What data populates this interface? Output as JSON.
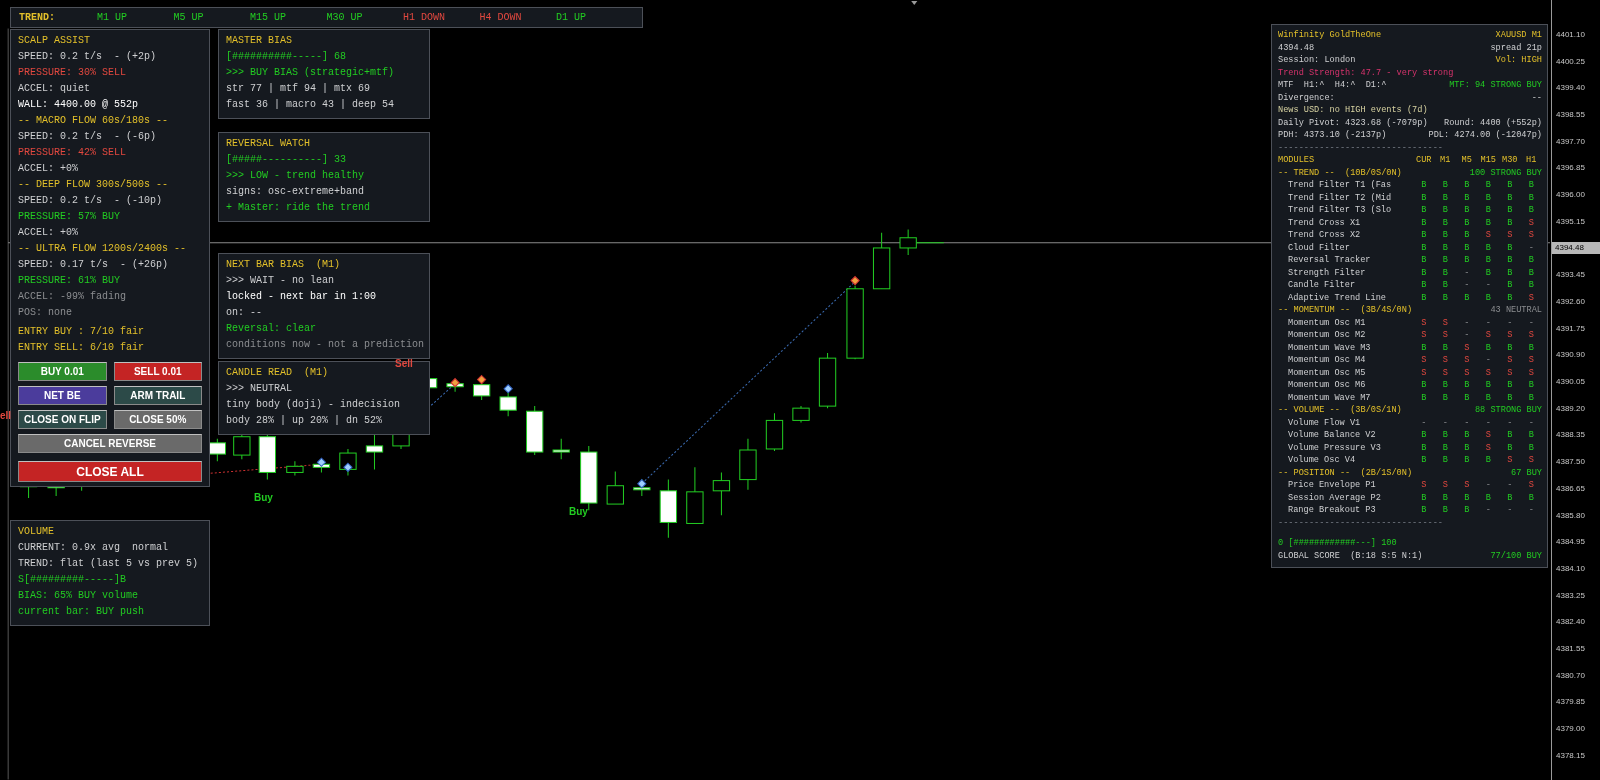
{
  "trend_bar": {
    "label": "TREND:",
    "items": [
      {
        "text": "M1 UP",
        "kind": "buy"
      },
      {
        "text": "M5 UP",
        "kind": "buy"
      },
      {
        "text": "M15 UP",
        "kind": "buy"
      },
      {
        "text": "M30 UP",
        "kind": "buy"
      },
      {
        "text": "H1 DOWN",
        "kind": "sell"
      },
      {
        "text": "H4 DOWN",
        "kind": "sell"
      },
      {
        "text": "D1 UP",
        "kind": "buy"
      }
    ]
  },
  "scalp_assist": {
    "lines": [
      {
        "text": "SCALP ASSIST",
        "kind": "heading"
      },
      {
        "text": "SPEED: 0.2 t/s  - (+2p)",
        "kind": "text"
      },
      {
        "text": "PRESSURE: 30% SELL",
        "kind": "sell"
      },
      {
        "text": "ACCEL: quiet",
        "kind": "text"
      },
      {
        "text": "WALL: 4400.00 @ 552p",
        "kind": "bright"
      },
      {
        "text": "-- MACRO FLOW 60s/180s --",
        "kind": "heading"
      },
      {
        "text": "SPEED: 0.2 t/s  - (-6p)",
        "kind": "text"
      },
      {
        "text": "PRESSURE: 42% SELL",
        "kind": "sell"
      },
      {
        "text": "ACCEL: +0%",
        "kind": "text"
      },
      {
        "text": "-- DEEP FLOW 300s/500s --",
        "kind": "heading"
      },
      {
        "text": "SPEED: 0.2 t/s  - (-10p)",
        "kind": "text"
      },
      {
        "text": "PRESSURE: 57% BUY",
        "kind": "buy"
      },
      {
        "text": "ACCEL: +0%",
        "kind": "text"
      },
      {
        "text": "-- ULTRA FLOW 1200s/2400s --",
        "kind": "heading"
      },
      {
        "text": "SPEED: 0.17 t/s  - (+26p)",
        "kind": "text"
      },
      {
        "text": "PRESSURE: 61% BUY",
        "kind": "buy"
      },
      {
        "text": "ACCEL: -99% fading",
        "kind": "dim"
      },
      {
        "text": "POS: none",
        "kind": "dim"
      }
    ],
    "entries": [
      {
        "text": "ENTRY BUY : 7/10 fair",
        "kind": "heading"
      },
      {
        "text": "ENTRY SELL: 6/10 fair",
        "kind": "heading"
      }
    ],
    "buttons": [
      {
        "label": "BUY 0.01",
        "color": "#2b8c2b",
        "kind": "half"
      },
      {
        "label": "SELL 0.01",
        "color": "#c42424",
        "kind": "half"
      },
      {
        "label": "NET BE",
        "color": "#4b3c9c",
        "kind": "half"
      },
      {
        "label": "ARM TRAIL",
        "color": "#2c4a48",
        "kind": "half"
      },
      {
        "label": "CLOSE ON FLIP",
        "color": "#2c4a48",
        "kind": "half"
      },
      {
        "label": "CLOSE 50%",
        "color": "#6a6a6a",
        "kind": "half"
      },
      {
        "label": "CANCEL REVERSE",
        "color": "#6a6a6a",
        "kind": "full"
      },
      {
        "label": "CLOSE ALL",
        "color": "#c42424",
        "kind": "full"
      }
    ]
  },
  "info_panels": [
    {
      "lines": [
        {
          "text": "MASTER BIAS",
          "kind": "heading"
        },
        {
          "text": "[##########-----] 68",
          "kind": "buy"
        },
        {
          "text": ">>> BUY BIAS (strategic+mtf)",
          "kind": "buy"
        },
        {
          "text": "str 77 | mtf 94 | mtx 69",
          "kind": "text"
        },
        {
          "text": "fast 36 | macro 43 | deep 54",
          "kind": "text"
        }
      ]
    },
    {
      "lines": [
        {
          "text": "REVERSAL WATCH",
          "kind": "heading"
        },
        {
          "text": "[#####----------] 33",
          "kind": "buy"
        },
        {
          "text": ">>> LOW - trend healthy",
          "kind": "buy"
        },
        {
          "text": "signs: osc-extreme+band",
          "kind": "text"
        },
        {
          "text": "+ Master: ride the trend",
          "kind": "buy"
        }
      ]
    },
    {
      "lines": [
        {
          "text": "NEXT BAR BIAS  (M1)",
          "kind": "heading"
        },
        {
          "text": ">>> WAIT - no lean",
          "kind": "text"
        },
        {
          "text": "locked - next bar in 1:00",
          "kind": "bright"
        },
        {
          "text": "on: --",
          "kind": "text"
        },
        {
          "text": "Reversal: clear",
          "kind": "buy"
        },
        {
          "text": "conditions now - not a prediction",
          "kind": "dim"
        }
      ]
    },
    {
      "lines": [
        {
          "text": "CANDLE READ  (M1)",
          "kind": "heading"
        },
        {
          "text": ">>> NEUTRAL",
          "kind": "text"
        },
        {
          "text": "tiny body (doji) - indecision",
          "kind": "text"
        },
        {
          "text": "body 28% | up 20% | dn 52%",
          "kind": "text"
        }
      ]
    },
    {
      "lines": [
        {
          "text": "VOLUME",
          "kind": "heading"
        },
        {
          "text": "CURRENT: 0.9x avg  normal",
          "kind": "text"
        },
        {
          "text": "TREND: flat (last 5 vs prev 5)",
          "kind": "text"
        },
        {
          "text": "S[#########-----]B",
          "kind": "buy"
        },
        {
          "text": "BIAS: 65% BUY volume",
          "kind": "buy"
        },
        {
          "text": "current bar: BUY push",
          "kind": "buy"
        }
      ]
    }
  ],
  "chart_labels": [
    {
      "text": "ell",
      "kind": "sell"
    },
    {
      "text": "Sell",
      "kind": "sell"
    },
    {
      "text": "Buy",
      "kind": "buy"
    },
    {
      "text": "Buy",
      "kind": "buy"
    }
  ],
  "dashboard": {
    "header_rows": [
      {
        "left": {
          "text": "Winfinity GoldTheOne",
          "kind": "heading"
        },
        "right": {
          "text": "XAUUSD M1",
          "kind": "heading"
        }
      },
      {
        "left": {
          "text": "4394.48",
          "kind": "text"
        },
        "right": {
          "text": "spread 21p",
          "kind": "text"
        }
      },
      {
        "left": {
          "text": "Session: London",
          "kind": "text"
        },
        "right": {
          "text": "Vol: HIGH",
          "kind": "heading"
        }
      },
      {
        "left": {
          "text": "Trend Strength: 47.7 - very strong",
          "kind": "pink"
        }
      },
      {
        "left": {
          "text": "MTF  H1:^  H4:^  D1:^",
          "kind": "text"
        },
        "right": {
          "text": "MTF: 94 STRONG BUY",
          "kind": "buy"
        }
      },
      {
        "left": {
          "text": "Divergence:",
          "kind": "text"
        },
        "right": {
          "text": "--",
          "kind": "text"
        }
      },
      {
        "left": {
          "text": "News USD: no HIGH events (7d)",
          "kind": "khaki"
        }
      },
      {
        "left": {
          "text": "Daily Pivot: 4323.68 (-7079p)",
          "kind": "text"
        },
        "right": {
          "text": "Round: 4400 (+552p)",
          "kind": "text"
        }
      },
      {
        "left": {
          "text": "PDH: 4373.10 (-2137p)",
          "kind": "text"
        },
        "right": {
          "text": "PDL: 4274.00 (-12047p)",
          "kind": "text"
        }
      }
    ],
    "divider": "--------------------------------",
    "columns": [
      "MODULES",
      "CUR",
      "M1",
      "M5",
      "M15",
      "M30",
      "H1"
    ],
    "groups": [
      {
        "label": "-- TREND --  (10B/0S/0N)",
        "summary": "100 STRONG BUY",
        "kind": "buy",
        "modules": [
          {
            "name": "Trend Filter T1 (Fas",
            "signals": [
              {
                "v": "B",
                "kind": "buy"
              },
              {
                "v": "B",
                "kind": "buy"
              },
              {
                "v": "B",
                "kind": "buy"
              },
              {
                "v": "B",
                "kind": "buy"
              },
              {
                "v": "B",
                "kind": "buy"
              },
              {
                "v": "B",
                "kind": "buy"
              }
            ]
          },
          {
            "name": "Trend Filter T2 (Mid",
            "signals": [
              {
                "v": "B",
                "kind": "buy"
              },
              {
                "v": "B",
                "kind": "buy"
              },
              {
                "v": "B",
                "kind": "buy"
              },
              {
                "v": "B",
                "kind": "buy"
              },
              {
                "v": "B",
                "kind": "buy"
              },
              {
                "v": "B",
                "kind": "buy"
              }
            ]
          },
          {
            "name": "Trend Filter T3 (Slo",
            "signals": [
              {
                "v": "B",
                "kind": "buy"
              },
              {
                "v": "B",
                "kind": "buy"
              },
              {
                "v": "B",
                "kind": "buy"
              },
              {
                "v": "B",
                "kind": "buy"
              },
              {
                "v": "B",
                "kind": "buy"
              },
              {
                "v": "B",
                "kind": "buy"
              }
            ]
          },
          {
            "name": "Trend Cross X1",
            "signals": [
              {
                "v": "B",
                "kind": "buy"
              },
              {
                "v": "B",
                "kind": "buy"
              },
              {
                "v": "B",
                "kind": "buy"
              },
              {
                "v": "B",
                "kind": "buy"
              },
              {
                "v": "B",
                "kind": "buy"
              },
              {
                "v": "S",
                "kind": "sell"
              }
            ]
          },
          {
            "name": "Trend Cross X2",
            "signals": [
              {
                "v": "B",
                "kind": "buy"
              },
              {
                "v": "B",
                "kind": "buy"
              },
              {
                "v": "B",
                "kind": "buy"
              },
              {
                "v": "S",
                "kind": "sell"
              },
              {
                "v": "S",
                "kind": "sell"
              },
              {
                "v": "S",
                "kind": "sell"
              }
            ]
          },
          {
            "name": "Cloud Filter",
            "signals": [
              {
                "v": "B",
                "kind": "buy"
              },
              {
                "v": "B",
                "kind": "buy"
              },
              {
                "v": "B",
                "kind": "buy"
              },
              {
                "v": "B",
                "kind": "buy"
              },
              {
                "v": "B",
                "kind": "buy"
              },
              {
                "v": "-",
                "kind": "none"
              }
            ]
          },
          {
            "name": "Reversal Tracker",
            "signals": [
              {
                "v": "B",
                "kind": "buy"
              },
              {
                "v": "B",
                "kind": "buy"
              },
              {
                "v": "B",
                "kind": "buy"
              },
              {
                "v": "B",
                "kind": "buy"
              },
              {
                "v": "B",
                "kind": "buy"
              },
              {
                "v": "B",
                "kind": "buy"
              }
            ]
          },
          {
            "name": "Strength Filter",
            "signals": [
              {
                "v": "B",
                "kind": "buy"
              },
              {
                "v": "B",
                "kind": "buy"
              },
              {
                "v": "-",
                "kind": "none"
              },
              {
                "v": "B",
                "kind": "buy"
              },
              {
                "v": "B",
                "kind": "buy"
              },
              {
                "v": "B",
                "kind": "buy"
              }
            ]
          },
          {
            "name": "Candle Filter",
            "signals": [
              {
                "v": "B",
                "kind": "buy"
              },
              {
                "v": "B",
                "kind": "buy"
              },
              {
                "v": "-",
                "kind": "none"
              },
              {
                "v": "-",
                "kind": "none"
              },
              {
                "v": "B",
                "kind": "buy"
              },
              {
                "v": "B",
                "kind": "buy"
              }
            ]
          },
          {
            "name": "Adaptive Trend Line",
            "signals": [
              {
                "v": "B",
                "kind": "buy"
              },
              {
                "v": "B",
                "kind": "buy"
              },
              {
                "v": "B",
                "kind": "buy"
              },
              {
                "v": "B",
                "kind": "buy"
              },
              {
                "v": "B",
                "kind": "buy"
              },
              {
                "v": "S",
                "kind": "sell"
              }
            ]
          }
        ]
      },
      {
        "label": "-- MOMENTUM --  (3B/4S/0N)",
        "summary": "43 NEUTRAL",
        "kind": "dim",
        "modules": [
          {
            "name": "Momentum Osc M1",
            "signals": [
              {
                "v": "S",
                "kind": "sell"
              },
              {
                "v": "S",
                "kind": "sell"
              },
              {
                "v": "-",
                "kind": "none"
              },
              {
                "v": "-",
                "kind": "none"
              },
              {
                "v": "-",
                "kind": "none"
              },
              {
                "v": "-",
                "kind": "none"
              }
            ]
          },
          {
            "name": "Momentum Osc M2",
            "signals": [
              {
                "v": "S",
                "kind": "sell"
              },
              {
                "v": "S",
                "kind": "sell"
              },
              {
                "v": "-",
                "kind": "none"
              },
              {
                "v": "S",
                "kind": "sell"
              },
              {
                "v": "S",
                "kind": "sell"
              },
              {
                "v": "S",
                "kind": "sell"
              }
            ]
          },
          {
            "name": "Momentum Wave M3",
            "signals": [
              {
                "v": "B",
                "kind": "buy"
              },
              {
                "v": "B",
                "kind": "buy"
              },
              {
                "v": "S",
                "kind": "sell"
              },
              {
                "v": "B",
                "kind": "buy"
              },
              {
                "v": "B",
                "kind": "buy"
              },
              {
                "v": "B",
                "kind": "buy"
              }
            ]
          },
          {
            "name": "Momentum Osc M4",
            "signals": [
              {
                "v": "S",
                "kind": "sell"
              },
              {
                "v": "S",
                "kind": "sell"
              },
              {
                "v": "S",
                "kind": "sell"
              },
              {
                "v": "-",
                "kind": "none"
              },
              {
                "v": "S",
                "kind": "sell"
              },
              {
                "v": "S",
                "kind": "sell"
              }
            ]
          },
          {
            "name": "Momentum Osc M5",
            "signals": [
              {
                "v": "S",
                "kind": "sell"
              },
              {
                "v": "S",
                "kind": "sell"
              },
              {
                "v": "S",
                "kind": "sell"
              },
              {
                "v": "S",
                "kind": "sell"
              },
              {
                "v": "S",
                "kind": "sell"
              },
              {
                "v": "S",
                "kind": "sell"
              }
            ]
          },
          {
            "name": "Momentum Osc M6",
            "signals": [
              {
                "v": "B",
                "kind": "buy"
              },
              {
                "v": "B",
                "kind": "buy"
              },
              {
                "v": "B",
                "kind": "buy"
              },
              {
                "v": "B",
                "kind": "buy"
              },
              {
                "v": "B",
                "kind": "buy"
              },
              {
                "v": "B",
                "kind": "buy"
              }
            ]
          },
          {
            "name": "Momentum Wave M7",
            "signals": [
              {
                "v": "B",
                "kind": "buy"
              },
              {
                "v": "B",
                "kind": "buy"
              },
              {
                "v": "B",
                "kind": "buy"
              },
              {
                "v": "B",
                "kind": "buy"
              },
              {
                "v": "B",
                "kind": "buy"
              },
              {
                "v": "B",
                "kind": "buy"
              }
            ]
          }
        ]
      },
      {
        "label": "-- VOLUME --  (3B/0S/1N)",
        "summary": "88 STRONG BUY",
        "kind": "buy",
        "modules": [
          {
            "name": "Volume Flow V1",
            "signals": [
              {
                "v": "-",
                "kind": "none"
              },
              {
                "v": "-",
                "kind": "none"
              },
              {
                "v": "-",
                "kind": "none"
              },
              {
                "v": "-",
                "kind": "none"
              },
              {
                "v": "-",
                "kind": "none"
              },
              {
                "v": "-",
                "kind": "none"
              }
            ]
          },
          {
            "name": "Volume Balance V2",
            "signals": [
              {
                "v": "B",
                "kind": "buy"
              },
              {
                "v": "B",
                "kind": "buy"
              },
              {
                "v": "B",
                "kind": "buy"
              },
              {
                "v": "S",
                "kind": "sell"
              },
              {
                "v": "B",
                "kind": "buy"
              },
              {
                "v": "B",
                "kind": "buy"
              }
            ]
          },
          {
            "name": "Volume Pressure V3",
            "signals": [
              {
                "v": "B",
                "kind": "buy"
              },
              {
                "v": "B",
                "kind": "buy"
              },
              {
                "v": "B",
                "kind": "buy"
              },
              {
                "v": "S",
                "kind": "sell"
              },
              {
                "v": "B",
                "kind": "buy"
              },
              {
                "v": "B",
                "kind": "buy"
              }
            ]
          },
          {
            "name": "Volume Osc V4",
            "signals": [
              {
                "v": "B",
                "kind": "buy"
              },
              {
                "v": "B",
                "kind": "buy"
              },
              {
                "v": "B",
                "kind": "buy"
              },
              {
                "v": "B",
                "kind": "buy"
              },
              {
                "v": "S",
                "kind": "sell"
              },
              {
                "v": "S",
                "kind": "sell"
              }
            ]
          }
        ]
      },
      {
        "label": "-- POSITION --  (2B/1S/0N)",
        "summary": "67 BUY",
        "kind": "buy",
        "modules": [
          {
            "name": "Price Envelope P1",
            "signals": [
              {
                "v": "S",
                "kind": "sell"
              },
              {
                "v": "S",
                "kind": "sell"
              },
              {
                "v": "S",
                "kind": "sell"
              },
              {
                "v": "-",
                "kind": "none"
              },
              {
                "v": "-",
                "kind": "none"
              },
              {
                "v": "S",
                "kind": "sell"
              }
            ]
          },
          {
            "name": "Session Average P2",
            "signals": [
              {
                "v": "B",
                "kind": "buy"
              },
              {
                "v": "B",
                "kind": "buy"
              },
              {
                "v": "B",
                "kind": "buy"
              },
              {
                "v": "B",
                "kind": "buy"
              },
              {
                "v": "B",
                "kind": "buy"
              },
              {
                "v": "B",
                "kind": "buy"
              }
            ]
          },
          {
            "name": "Range Breakout P3",
            "signals": [
              {
                "v": "B",
                "kind": "buy"
              },
              {
                "v": "B",
                "kind": "buy"
              },
              {
                "v": "B",
                "kind": "buy"
              },
              {
                "v": "-",
                "kind": "none"
              },
              {
                "v": "-",
                "kind": "none"
              },
              {
                "v": "-",
                "kind": "none"
              }
            ]
          }
        ]
      }
    ],
    "footer_divider": "--------------------------------",
    "score_bar": "0 [############---] 100",
    "global_score": {
      "label": "GLOBAL SCORE  (B:18 S:5 N:1)",
      "value": "77/100 BUY"
    }
  },
  "price_axis": {
    "labels_above": [
      "4401.10",
      "4400.25",
      "4399.40",
      "4398.55",
      "4397.70",
      "4396.85",
      "4396.00",
      "4395.15"
    ],
    "current_price": "4394.48",
    "labels_below": [
      "4393.45",
      "4392.60",
      "4391.75",
      "4390.90",
      "4390.05",
      "4389.20",
      "4388.35",
      "4387.50",
      "4386.65",
      "4385.80",
      "4384.95",
      "4384.10",
      "4383.25",
      "4382.40",
      "4381.55",
      "4380.70",
      "4379.85",
      "4379.00",
      "4378.15"
    ]
  }
}
